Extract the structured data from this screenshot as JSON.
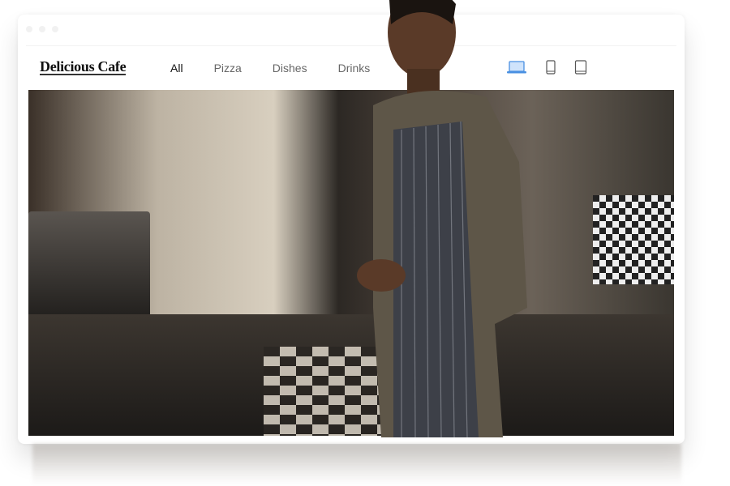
{
  "site": {
    "logo": "Delicious Cafe"
  },
  "nav": {
    "items": [
      {
        "label": "All",
        "active": true
      },
      {
        "label": "Pizza"
      },
      {
        "label": "Dishes"
      },
      {
        "label": "Drinks"
      }
    ]
  },
  "devices": [
    {
      "icon": "laptop-icon",
      "active": true
    },
    {
      "icon": "phone-icon"
    },
    {
      "icon": "tablet-icon"
    }
  ],
  "colors": {
    "accent": "#4a90e2"
  }
}
